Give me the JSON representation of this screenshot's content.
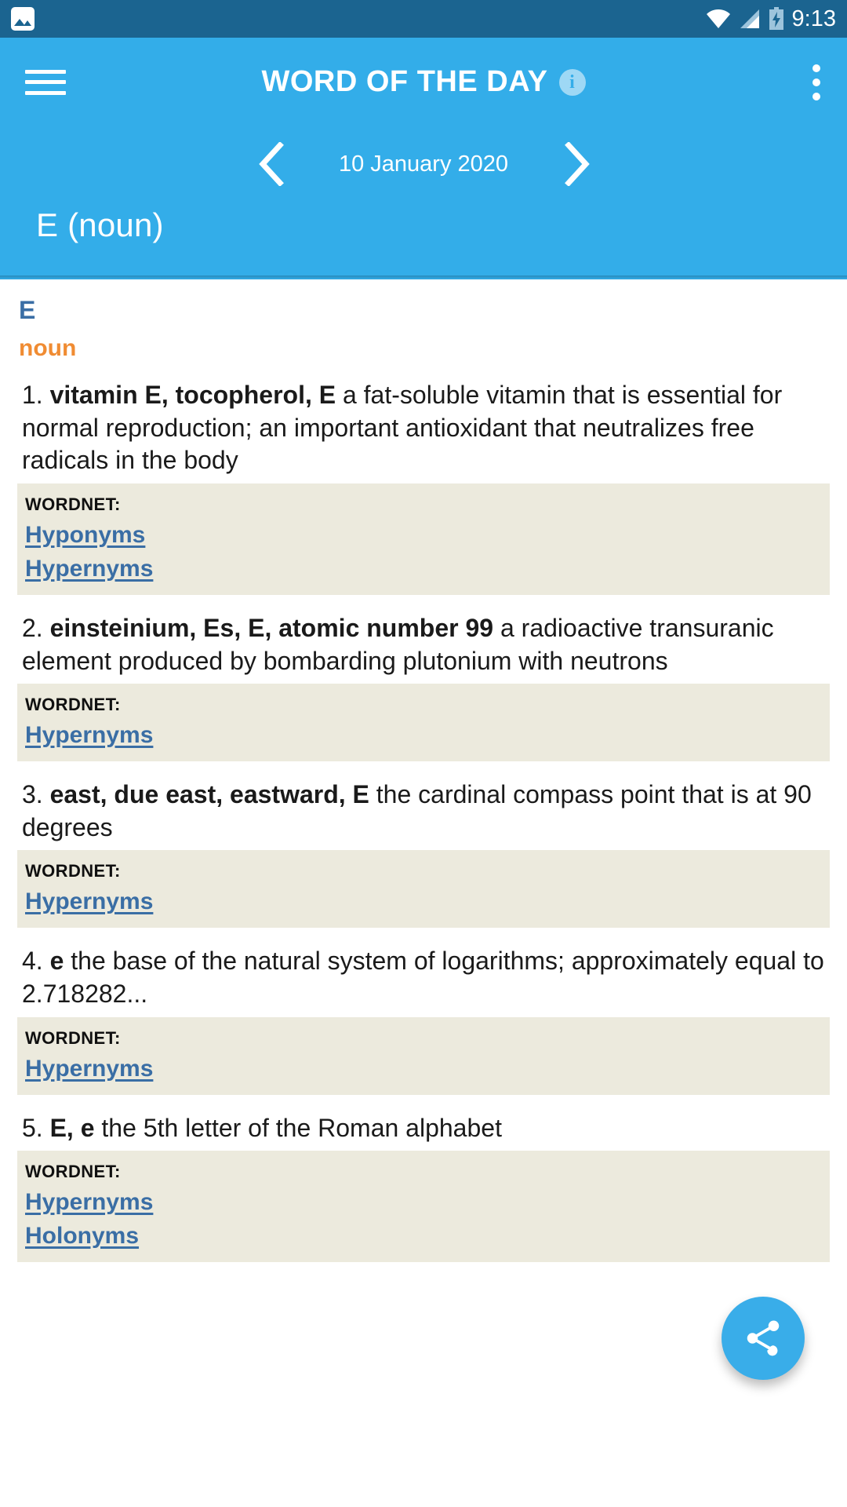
{
  "status_bar": {
    "notification_icon": "image-icon",
    "wifi_icon": "wifi-icon",
    "signal_icon": "signal-icon",
    "battery_icon": "battery-charging-icon",
    "time": "9:13",
    "background_color": "#1b6490"
  },
  "app_bar": {
    "menu_icon": "hamburger-menu-icon",
    "title": "WORD OF THE DAY",
    "info_icon": "info-icon",
    "info_glyph": "i",
    "overflow_icon": "more-vertical-icon",
    "background_color": "#33ade9",
    "date_nav": {
      "prev_icon": "chevron-left-icon",
      "date": "10 January 2020",
      "next_icon": "chevron-right-icon"
    },
    "word_heading": "E (noun)"
  },
  "entry": {
    "word": "E",
    "word_color": "#3a6ea5",
    "part_of_speech": "noun",
    "pos_color": "#f08c33",
    "wordnet_label": "WORDNET:",
    "wordnet_box_color": "#eceadd",
    "link_color": "#3a6ea5",
    "senses": [
      {
        "number": "1.",
        "headwords": "vitamin E, tocopherol, E",
        "definition": "a fat-soluble vitamin that is essential for normal reproduction; an important antioxidant that neutralizes free radicals in the body",
        "links": [
          "Hyponyms",
          "Hypernyms"
        ]
      },
      {
        "number": "2.",
        "headwords": "einsteinium, Es, E, atomic number 99",
        "definition": "a radioactive transuranic element produced by bombarding plutonium with neutrons",
        "links": [
          "Hypernyms"
        ]
      },
      {
        "number": "3.",
        "headwords": "east, due east, eastward, E",
        "definition": "the cardinal compass point that is at 90 degrees",
        "links": [
          "Hypernyms"
        ]
      },
      {
        "number": "4.",
        "headwords": "e",
        "definition": "the base of the natural system of logarithms; approximately equal to 2.718282...",
        "links": [
          "Hypernyms"
        ]
      },
      {
        "number": "5.",
        "headwords": "E, e",
        "definition": "the 5th letter of the Roman alphabet",
        "links": [
          "Hypernyms",
          "Holonyms"
        ]
      }
    ]
  },
  "fab": {
    "icon": "share-icon",
    "color": "#39ade9"
  }
}
